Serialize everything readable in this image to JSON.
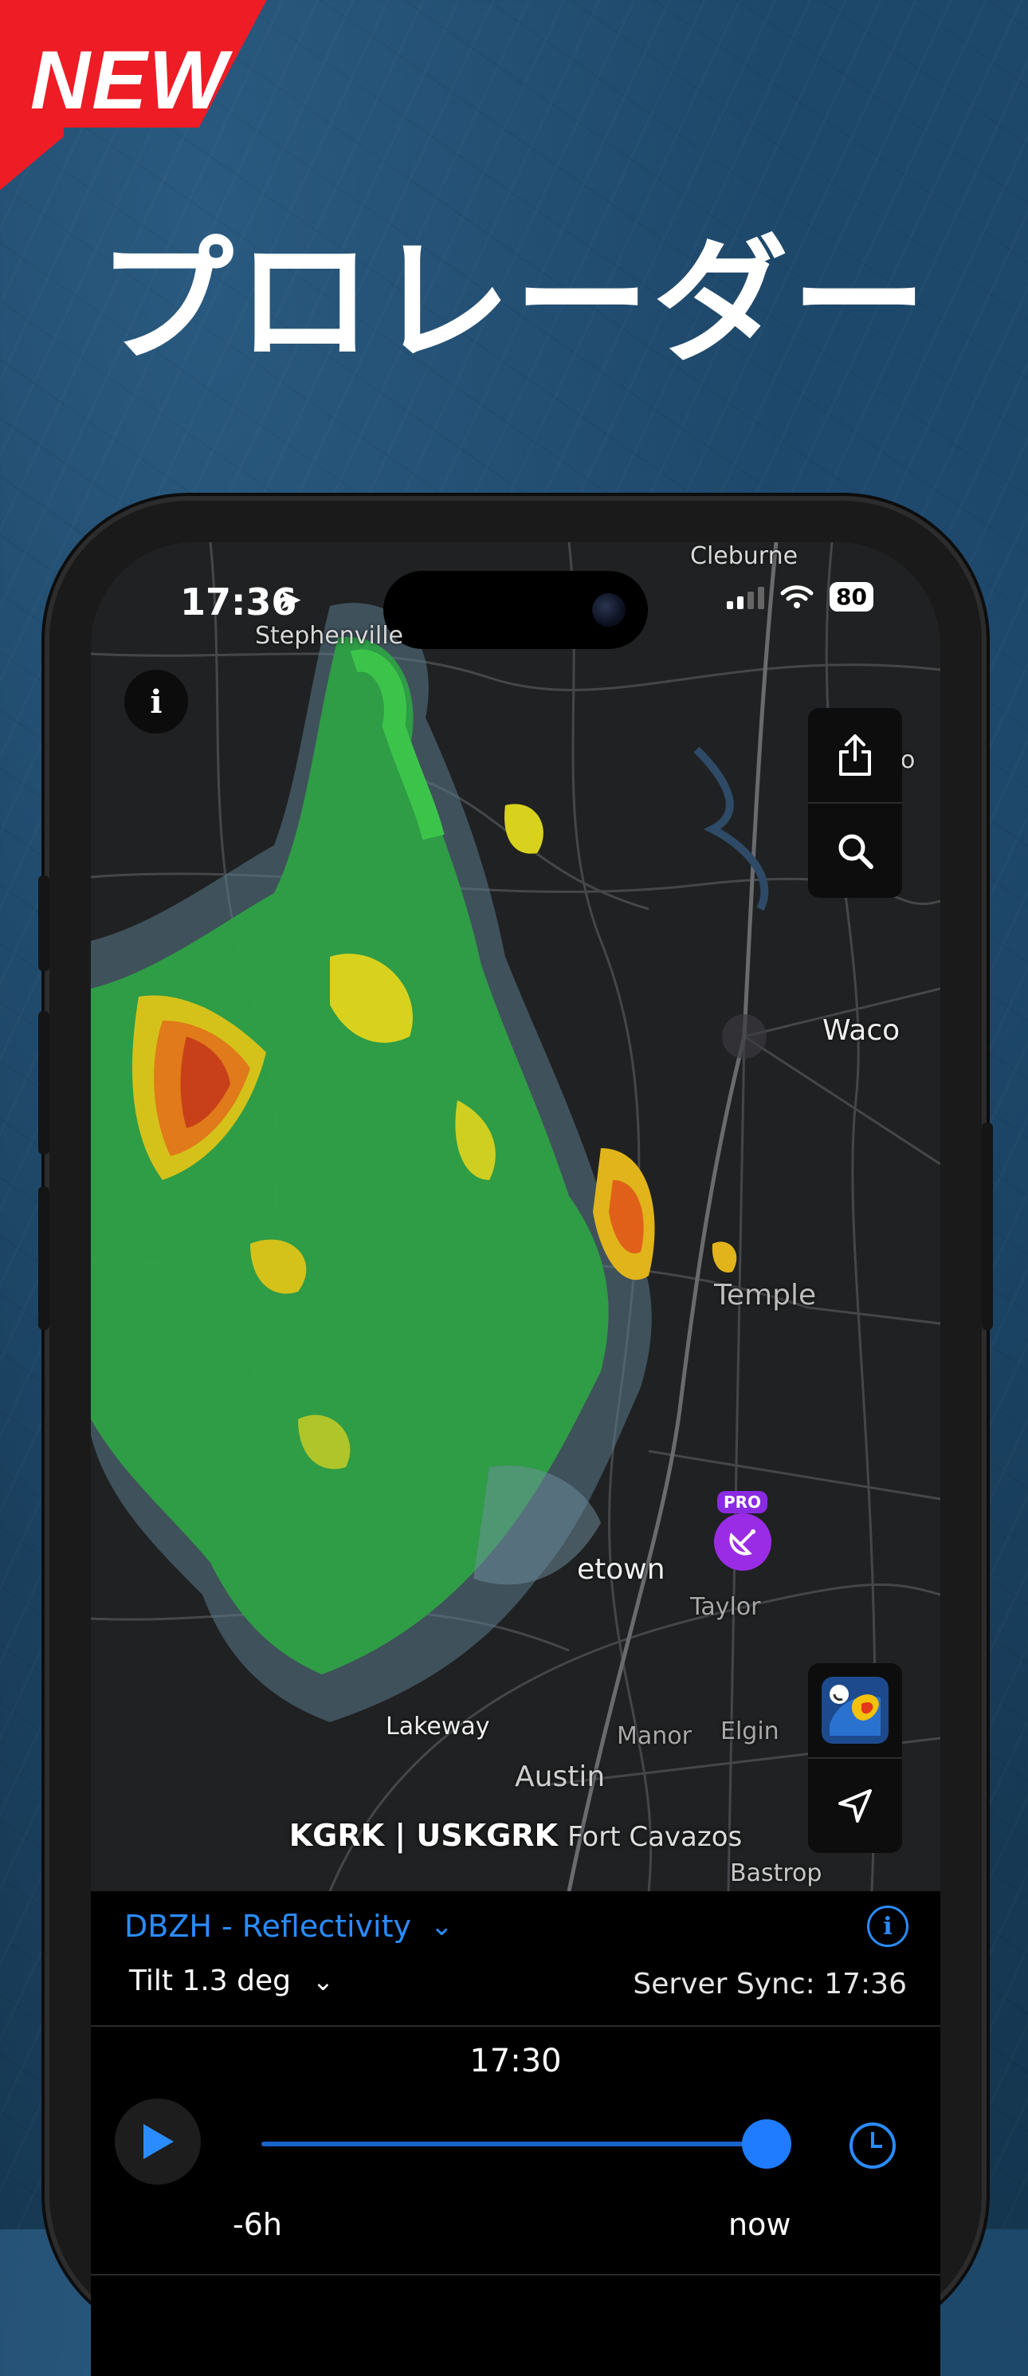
{
  "promo": {
    "badge": "NEW",
    "headline": "プロレーダー"
  },
  "status_bar": {
    "time": "17:36",
    "battery": "80"
  },
  "map": {
    "cities": [
      "Cleburne",
      "Stephenville",
      "Waco",
      "Temple",
      "etown",
      "Taylor",
      "Lakeway",
      "Manor",
      "Elgin",
      "Austin",
      "Bastrop",
      "o"
    ],
    "station_id": "KGRK | USKGRK",
    "station_location": "Fort Cavazos",
    "pro_tag": "PRO"
  },
  "controls": {
    "product": "DBZH - Reflectivity",
    "tilt": "Tilt 1.3 deg",
    "server_sync": "Server Sync: 17:36",
    "current_time": "17:30",
    "range_start": "-6h",
    "range_end": "now",
    "timeline_position": 1.0
  },
  "icons": {
    "location": "location-arrow-icon",
    "info": "info-icon",
    "share": "share-icon",
    "search": "search-icon",
    "layers": "radar-layers-icon",
    "navigate": "navigate-icon",
    "play": "play-icon",
    "history": "clock-icon"
  },
  "colors": {
    "accent": "#2a8cff",
    "badge_red": "#ee1c25",
    "pro_purple": "#9b2ce6"
  }
}
